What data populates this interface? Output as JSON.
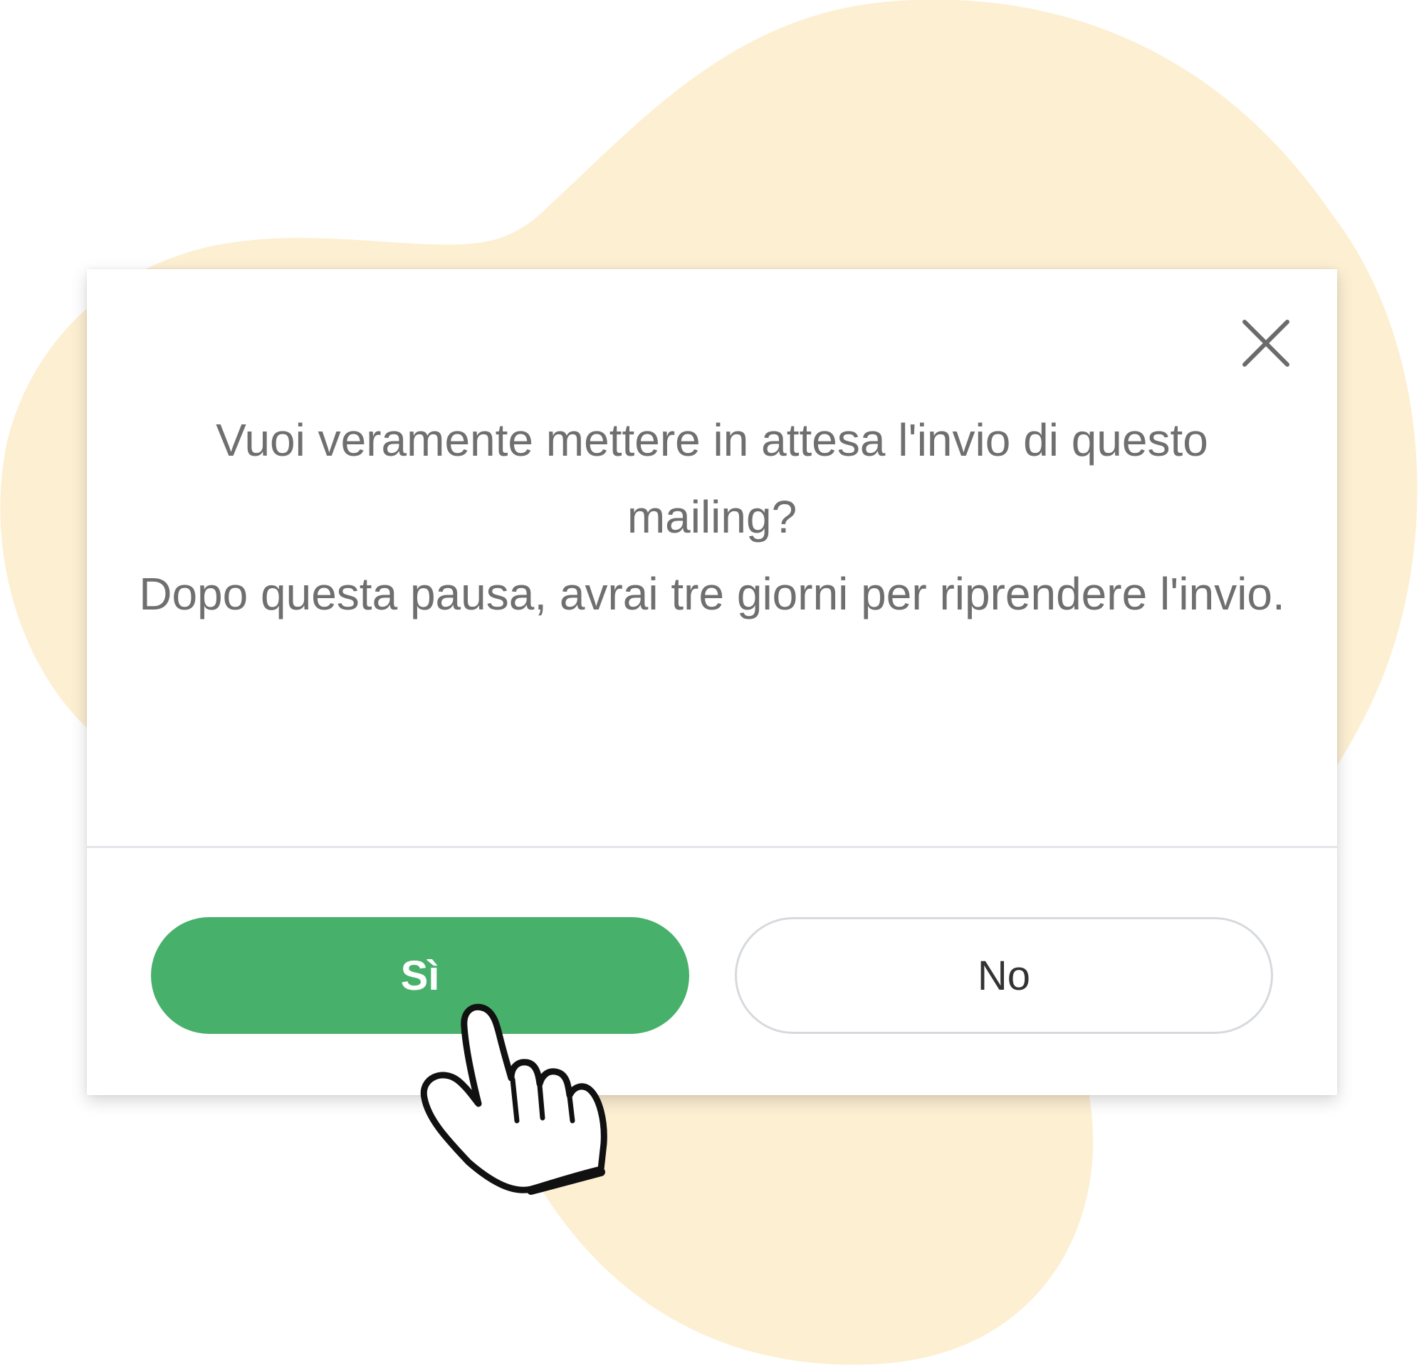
{
  "colors": {
    "blob": "#fdefd2",
    "primary_button": "#47b06a",
    "message_text": "#6f6f6f",
    "divider": "#e3e6ea"
  },
  "dialog": {
    "close_icon": "close-icon",
    "message_line1": "Vuoi veramente mettere in attesa l'invio di questo mailing?",
    "message_line2": "Dopo questa pausa, avrai tre giorni per riprendere l'invio.",
    "confirm_label": "Sì",
    "cancel_label": "No"
  },
  "cursor_icon": "hand-pointer-icon"
}
